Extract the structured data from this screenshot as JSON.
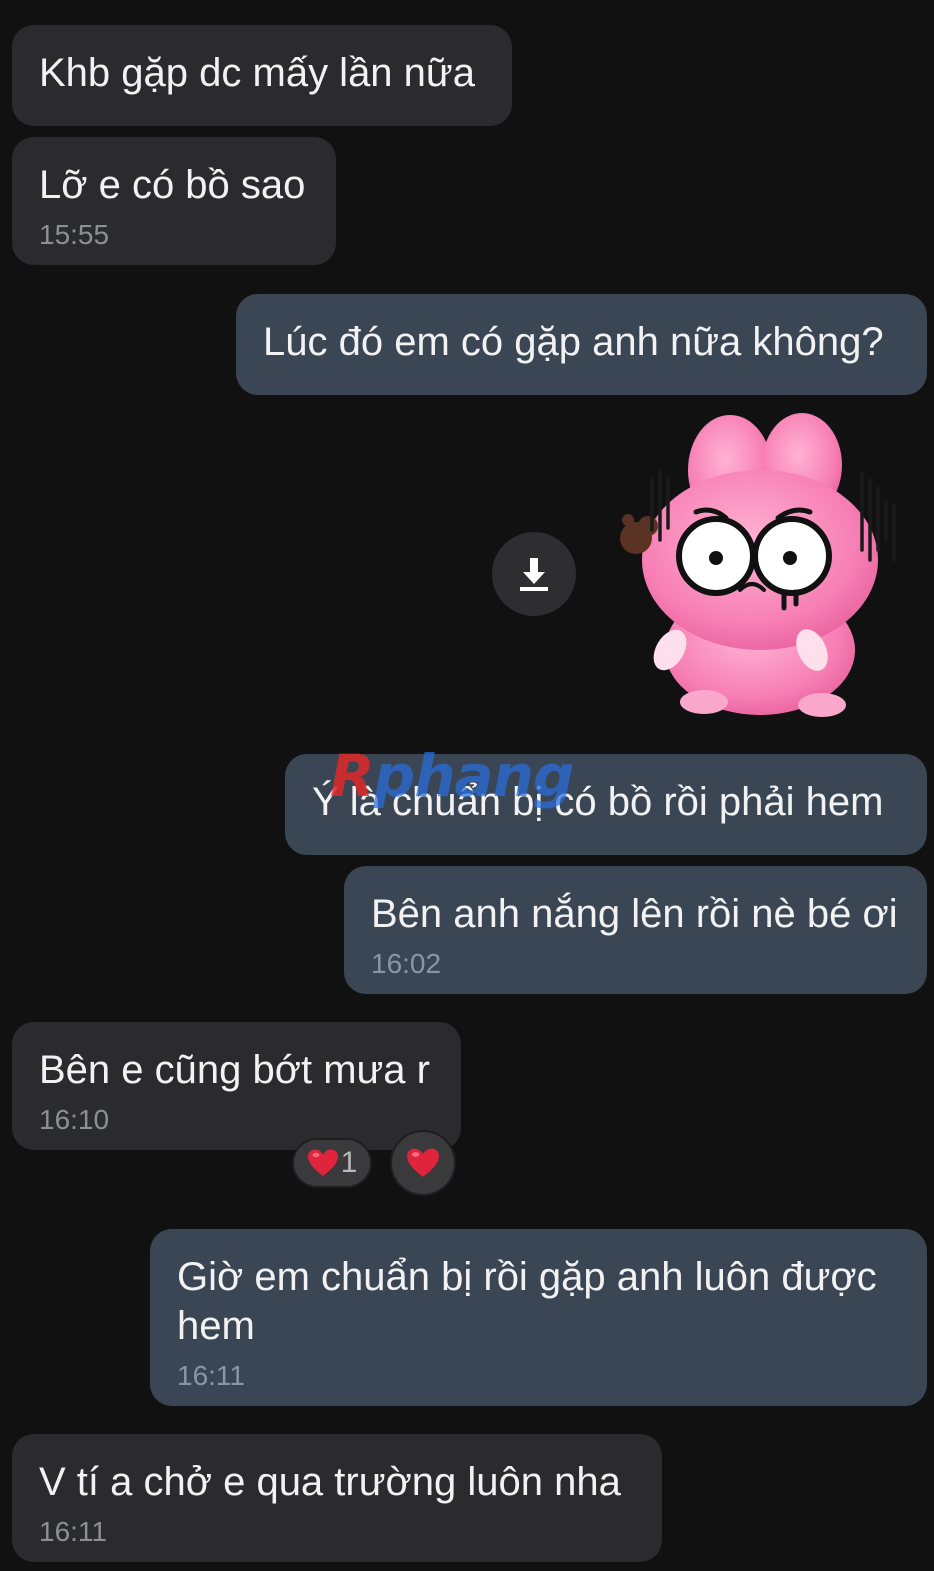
{
  "messages": [
    {
      "direction": "incoming",
      "text": "Khb gặp dc mấy lần nữa",
      "time": ""
    },
    {
      "direction": "incoming",
      "text": "Lỡ e có bồ sao",
      "time": "15:55"
    },
    {
      "direction": "outgoing",
      "text": "Lúc đó em có gặp anh nữa không?",
      "time": ""
    },
    {
      "direction": "outgoing",
      "type": "sticker",
      "sticker_icon": "pink-rabbit-worried-sticker"
    },
    {
      "direction": "outgoing",
      "text": "Ý là chuẩn bị có bồ rồi phải hem",
      "time": ""
    },
    {
      "direction": "outgoing",
      "text": "Bên anh nắng lên rồi nè bé ơi",
      "time": "16:02"
    },
    {
      "direction": "incoming",
      "text": "Bên e cũng bớt mưa r",
      "time": "16:10",
      "reactions": [
        {
          "icon": "heart-icon",
          "count": "1"
        }
      ]
    },
    {
      "direction": "outgoing",
      "text": "Giờ em chuẩn bị rồi gặp anh luôn được hem",
      "time": "16:11"
    },
    {
      "direction": "incoming",
      "text": "V tí a chở e qua trường luôn nha",
      "time": "16:11"
    }
  ],
  "download_icon": "download-icon",
  "add_reaction_icon": "heart-icon",
  "watermark": {
    "first_letter": "R",
    "rest": "phang"
  },
  "colors": {
    "background": "#111112",
    "incoming_bubble": "#2b2b2d",
    "outgoing_bubble": "#3a4654",
    "text": "#f2f2f2",
    "timestamp": "#8c8f94",
    "heart": "#e0243b",
    "sticker_pink": "#f77fb4"
  }
}
